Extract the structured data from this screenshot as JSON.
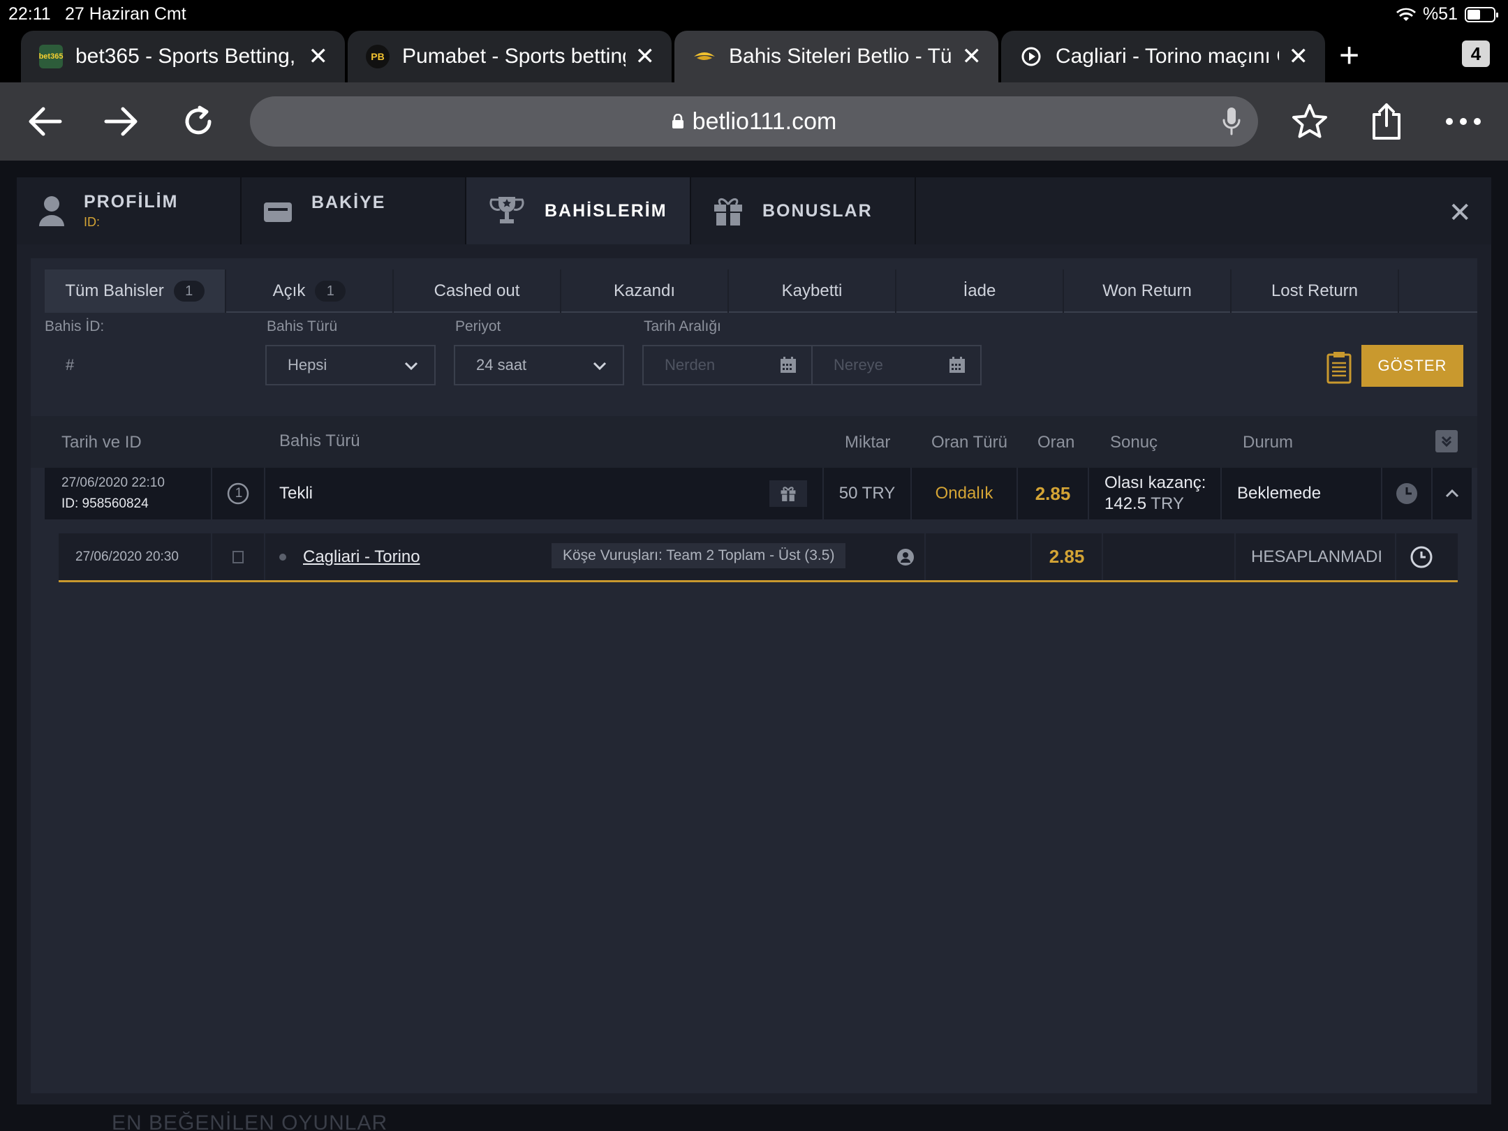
{
  "status": {
    "time": "22:11",
    "date": "27 Haziran Cmt",
    "battery": "%51"
  },
  "browser_tabs": [
    {
      "title": "bet365 - Sports Betting,",
      "favicon": "bet365-favicon",
      "favicon_text": "bet365",
      "active": false
    },
    {
      "title": "Pumabet - Sports betting",
      "favicon": "pumabet-favicon",
      "favicon_text": "PB",
      "active": false
    },
    {
      "title": "Bahis Siteleri Betlio - Türk",
      "favicon": "betlio-favicon",
      "active": true
    },
    {
      "title": "Cagliari - Torino maçını Ca",
      "favicon": "play-favicon",
      "active": false
    }
  ],
  "tab_count": "4",
  "url": "betlio111.com",
  "account_tabs": [
    {
      "label": "PROFİLİM",
      "sub": "ID:",
      "icon": "user-icon"
    },
    {
      "label": "BAKİYE",
      "icon": "wallet-icon"
    },
    {
      "label": "BAHİSLERİM",
      "icon": "trophy-icon",
      "active": true
    },
    {
      "label": "BONUSLAR",
      "icon": "gift-icon"
    }
  ],
  "filter_tabs": [
    {
      "label": "Tüm Bahisler",
      "count": "1",
      "active": true
    },
    {
      "label": "Açık",
      "count": "1"
    },
    {
      "label": "Cashed out"
    },
    {
      "label": "Kazandı"
    },
    {
      "label": "Kaybetti"
    },
    {
      "label": "İade"
    },
    {
      "label": "Won Return"
    },
    {
      "label": "Lost Return"
    }
  ],
  "filters": {
    "bet_id_label": "Bahis İD:",
    "bet_id_placeholder": "#",
    "bet_type_label": "Bahis Türü",
    "bet_type_value": "Hepsi",
    "period_label": "Periyot",
    "period_value": "24 saat",
    "date_range_label": "Tarih Aralığı",
    "from_placeholder": "Nerden",
    "to_placeholder": "Nereye",
    "show_button": "GÖSTER"
  },
  "table": {
    "headers": {
      "date_id": "Tarih ve ID",
      "bet_type": "Bahis Türü",
      "amount": "Miktar",
      "odds_type": "Oran Türü",
      "odds": "Oran",
      "result": "Sonuç",
      "status": "Durum"
    },
    "bet": {
      "date": "27/06/2020 22:10",
      "id": "ID: 958560824",
      "count": "1",
      "type": "Tekli",
      "amount": "50 TRY",
      "odds_type": "Ondalık",
      "odds": "2.85",
      "result_label": "Olası kazanç:",
      "result_value": "142.5",
      "result_currency": "TRY",
      "status": "Beklemede"
    },
    "selection": {
      "date": "27/06/2020 20:30",
      "match": "Cagliari - Torino",
      "market": "Köşe Vuruşları: Team 2 Toplam - Üst (3.5)",
      "odds": "2.85",
      "status": "HESAPLANMADI"
    }
  },
  "background_text": "EN BEĞENİLEN OYUNLAR",
  "colors": {
    "accent": "#c9992e",
    "gold_text": "#d4a435"
  }
}
